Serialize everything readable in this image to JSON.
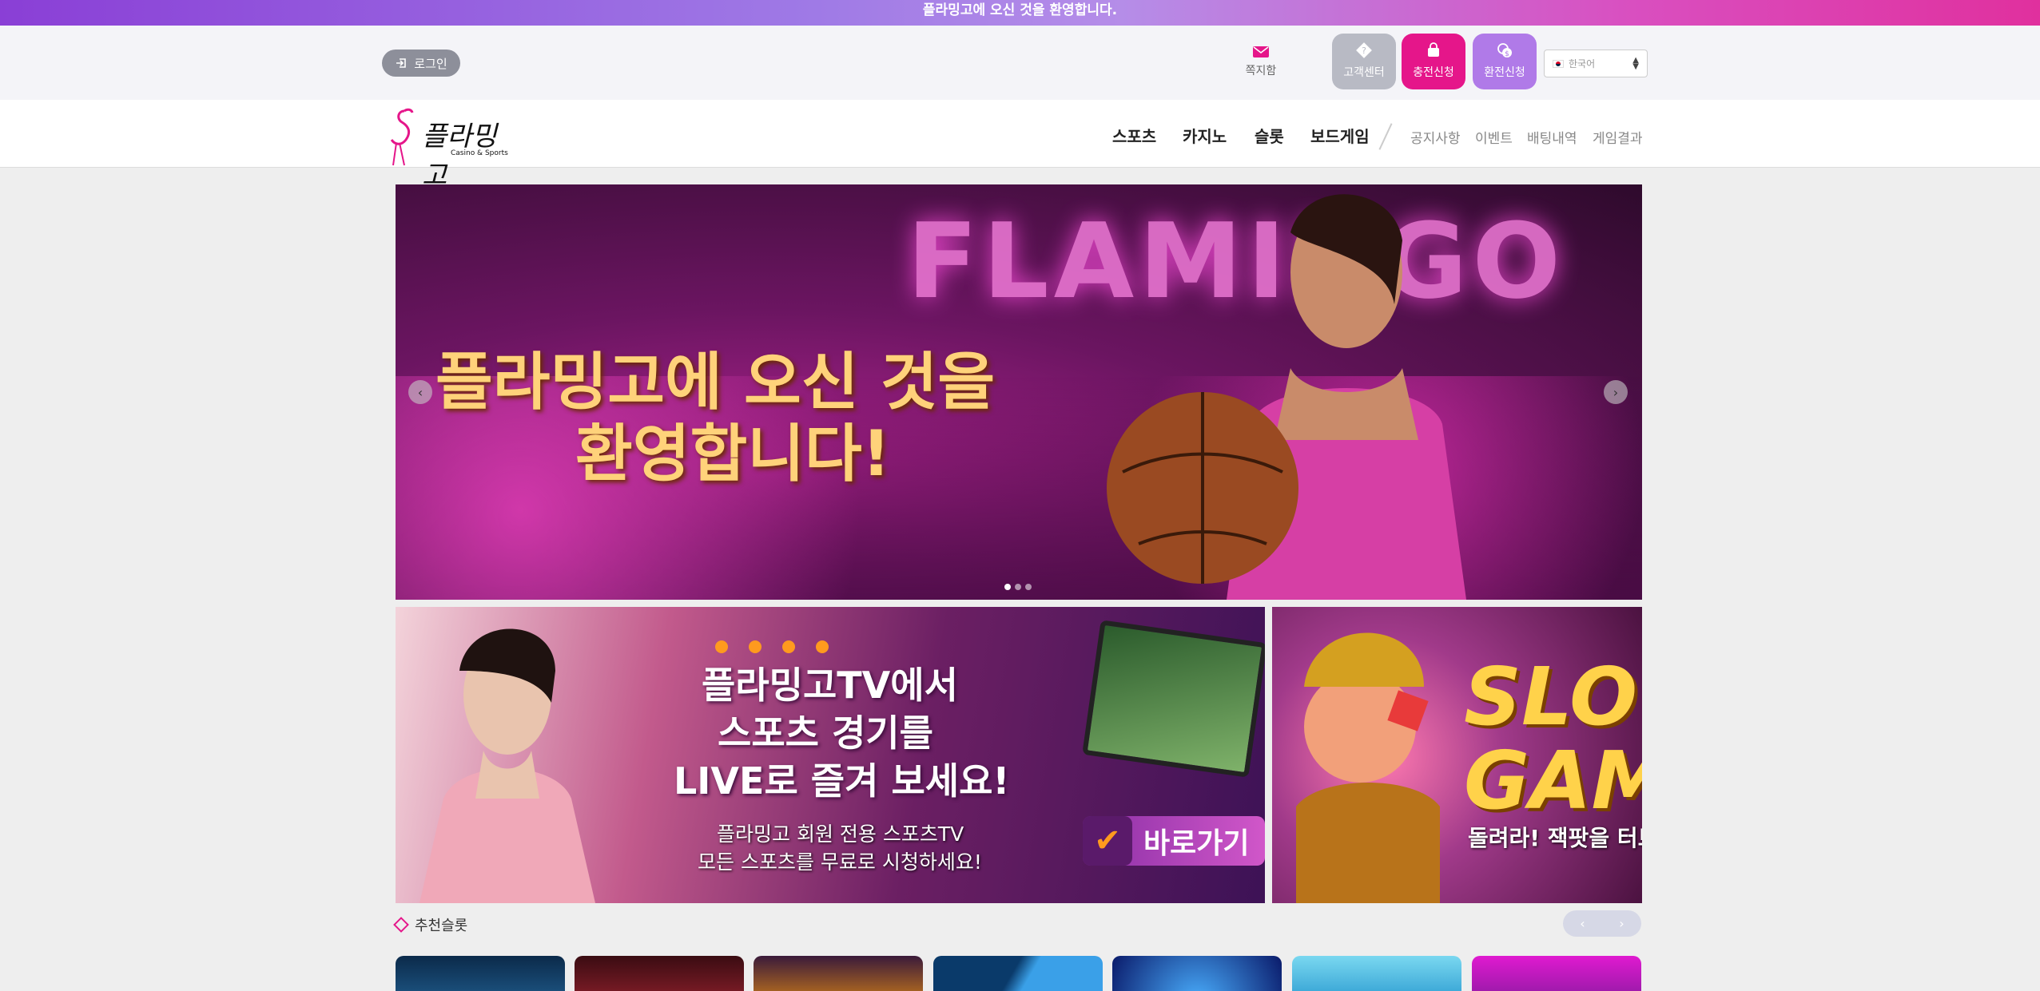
{
  "top_banner": {
    "text": "플라밍고에 오신 것을 환영합니다."
  },
  "header": {
    "login_label": "로그인",
    "message_label": "쪽지함",
    "support_label": "고객센터",
    "deposit_label": "충전신청",
    "withdraw_label": "환전신청",
    "language": "한국어"
  },
  "logo": {
    "text": "플라밍고",
    "subtitle": "Casino & Sports"
  },
  "nav": {
    "main": [
      "스포츠",
      "카지노",
      "슬롯",
      "보드게임"
    ],
    "sub": [
      "공지사항",
      "이벤트",
      "배팅내역",
      "게임결과"
    ]
  },
  "carousel": {
    "sign": "FLAMINGO",
    "line1": "플라밍고에 오신 것을",
    "line2": "환영합니다!",
    "slide_count": 3,
    "active_slide": 1
  },
  "promo_tv": {
    "line1": "플라밍고TV에서",
    "line2": "스포츠 경기를",
    "line3": "LIVE로 즐겨 보세요!",
    "sub1": "플라밍고 회원 전용 스포츠TV",
    "sub2": "모든 스포츠를 무료로 시청하세요!",
    "button": "바로가기"
  },
  "promo_slot": {
    "title1": "SLO",
    "title2": "GAME",
    "sub": "돌려라! 잭팟을 터트"
  },
  "recommended": {
    "title": "추천슬롯"
  },
  "colors": {
    "accent_pink": "#e5168a",
    "accent_purple": "#b07ae8",
    "support_gray": "#b8bac4"
  }
}
